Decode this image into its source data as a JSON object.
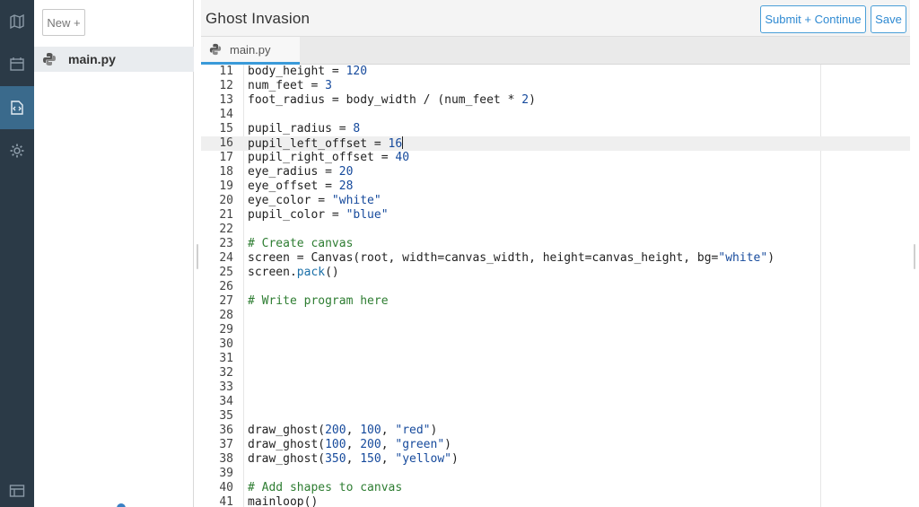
{
  "app": {
    "title": "Ghost Invasion",
    "submit_label": "Submit + Continue",
    "save_label": "Save",
    "new_label": "New +"
  },
  "files": [
    {
      "name": "main.py"
    }
  ],
  "tabs": [
    {
      "label": "main.py"
    }
  ],
  "sidebar": {
    "icons": [
      "map-icon",
      "calendar-icon",
      "code-icon",
      "gear-icon",
      "layout-icon"
    ],
    "active_icon": "code-icon"
  },
  "colors": {
    "rail": "#2b3a47",
    "accent": "#3a9ad9",
    "number": "#164a9c",
    "comment": "#2e7d32"
  },
  "editor": {
    "active_line": 16,
    "lines": [
      {
        "n": "11",
        "t": "body_height = 120"
      },
      {
        "n": "12",
        "t": "num_feet = 3"
      },
      {
        "n": "13",
        "t": "foot_radius = body_width / (num_feet * 2)"
      },
      {
        "n": "14",
        "t": ""
      },
      {
        "n": "15",
        "t": "pupil_radius = 8"
      },
      {
        "n": "16",
        "t": "pupil_left_offset = 16"
      },
      {
        "n": "17",
        "t": "pupil_right_offset = 40"
      },
      {
        "n": "18",
        "t": "eye_radius = 20"
      },
      {
        "n": "19",
        "t": "eye_offset = 28"
      },
      {
        "n": "20",
        "t": "eye_color = \"white\""
      },
      {
        "n": "21",
        "t": "pupil_color = \"blue\""
      },
      {
        "n": "22",
        "t": ""
      },
      {
        "n": "23",
        "t": "# Create canvas"
      },
      {
        "n": "24",
        "t": "screen = Canvas(root, width=canvas_width, height=canvas_height, bg=\"white\")"
      },
      {
        "n": "25",
        "t": "screen.pack()"
      },
      {
        "n": "26",
        "t": ""
      },
      {
        "n": "27",
        "t": "# Write program here"
      },
      {
        "n": "28",
        "t": ""
      },
      {
        "n": "29",
        "t": ""
      },
      {
        "n": "30",
        "t": ""
      },
      {
        "n": "31",
        "t": ""
      },
      {
        "n": "32",
        "t": ""
      },
      {
        "n": "33",
        "t": ""
      },
      {
        "n": "34",
        "t": ""
      },
      {
        "n": "35",
        "t": ""
      },
      {
        "n": "36",
        "t": "draw_ghost(200, 100, \"red\")"
      },
      {
        "n": "37",
        "t": "draw_ghost(100, 200, \"green\")"
      },
      {
        "n": "38",
        "t": "draw_ghost(350, 150, \"yellow\")"
      },
      {
        "n": "39",
        "t": ""
      },
      {
        "n": "40",
        "t": "# Add shapes to canvas"
      },
      {
        "n": "41",
        "t": "mainloop()"
      }
    ]
  }
}
